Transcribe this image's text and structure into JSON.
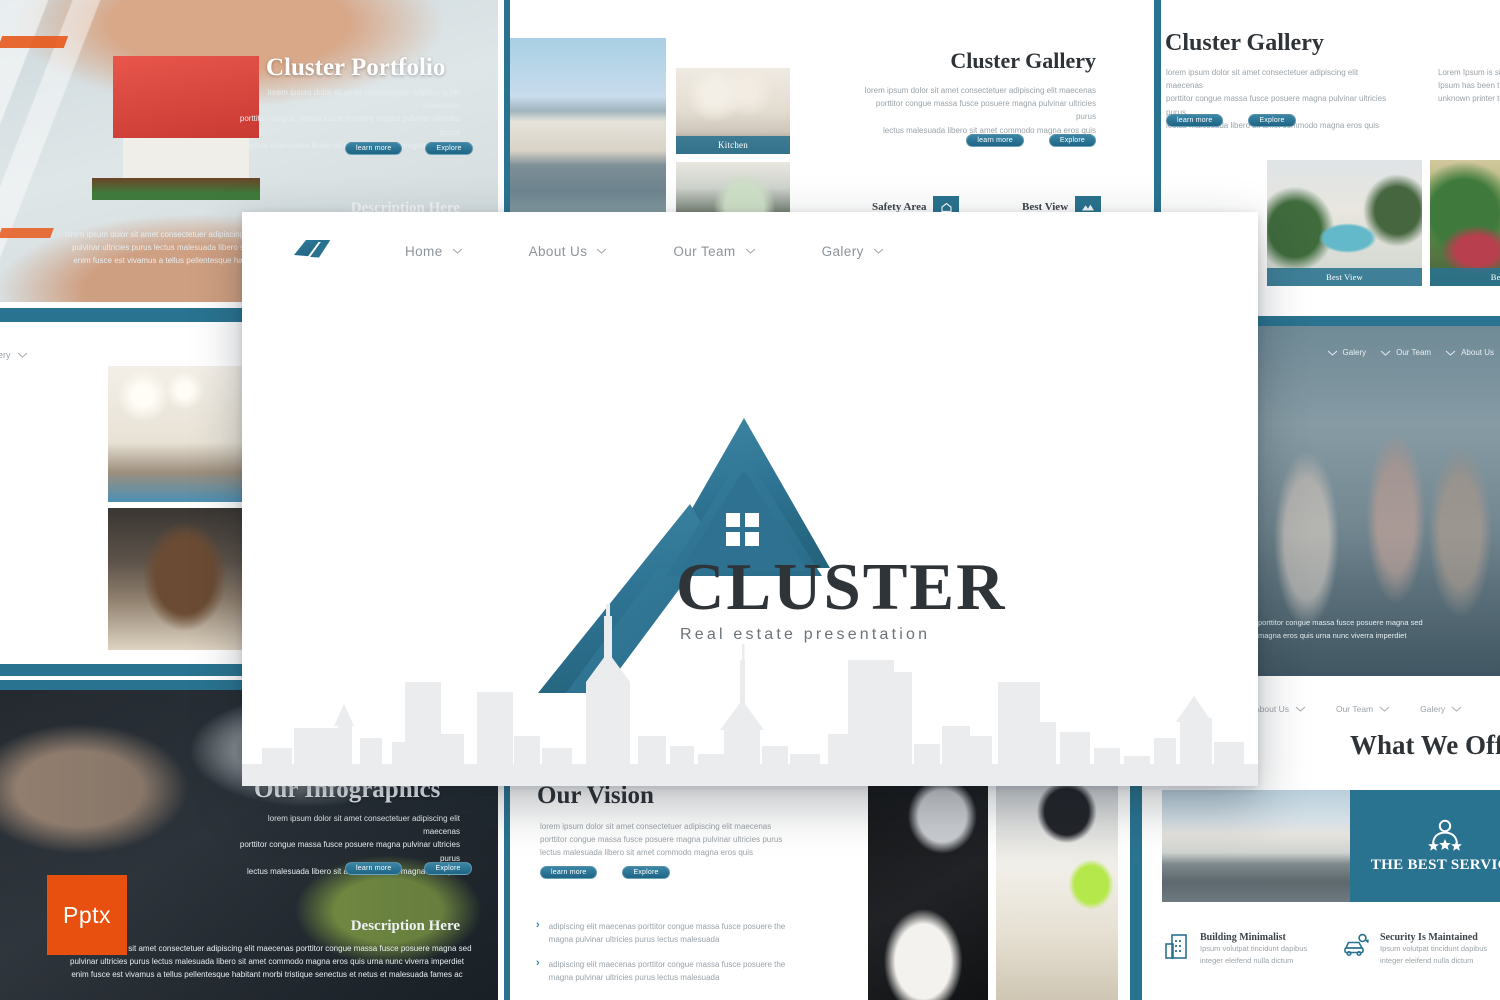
{
  "theme": {
    "accent": "#2a7390",
    "accent_light": "#3a86a6",
    "accent_dark": "#1f6484",
    "badge_orange": "#e8500f",
    "text_dark": "#2e3338",
    "text_muted": "#9aa3a9"
  },
  "card": {
    "navbar": {
      "logo_icon": "cluster-mark-icon",
      "items": [
        {
          "label": "Home",
          "icon": "chevron-down-icon"
        },
        {
          "label": "About Us",
          "icon": "chevron-down-icon"
        },
        {
          "label": "Our Team",
          "icon": "chevron-down-icon"
        },
        {
          "label": "Galery",
          "icon": "chevron-down-icon"
        }
      ]
    },
    "hero": {
      "logo_icon": "house-roof-a-icon",
      "window_icon": "four-pane-window-icon",
      "brand": "CLUSTER",
      "tagline": "Real estate presentation",
      "skyline_icon": "city-skyline-icon"
    }
  },
  "lorem": {
    "line1": "lorem ipsum dolor sit amet consectetuer adipiscing elit maecenas",
    "line2": "porttitor congue massa fusce posuere magna pulvinar ultricies purus",
    "line3": "lectus malesuada libero sit amet commodo magna eros quis",
    "desc_line1": "lorem ipsum dolor sit amet consectetuer adipiscing elit maecenas porttitor congue massa fusce posuere magna sed",
    "desc_line2": "pulvinar ultricies purus lectus malesuada libero sit amet commodo magna eros quis urna nunc viverra imperdiet",
    "desc_line3": "enim fusce est vivamus a tellus pellentesque habitant morbi tristique senectus et netus et malesuada fames ac",
    "bullet": "adipiscing elit maecenas porttitor congue massa fusce posuere the magna pulvinar ultricies purus lectus malesuada",
    "ipsum_col1": "Lorem Ipsum is simply",
    "ipsum_col2": "Ipsum has been the",
    "ipsum_col3": "unknown printer to",
    "team_line1": "porttitor congue massa fusce posuere magna sed",
    "team_line2": "magna eros quis urna nunc viverra imperdiet",
    "team_left": "rem",
    "team_left2": "purus"
  },
  "buttons": {
    "learn_more": "learn more",
    "explore": "Explore"
  },
  "slides": {
    "portfolio": {
      "title": "Cluster Portfolio",
      "description_heading": "Description Here"
    },
    "gallery_mid": {
      "title": "Cluster Gallery",
      "features": [
        {
          "label": "Safety Area",
          "icon": "shield-house-icon"
        },
        {
          "label": "Best View",
          "icon": "mountain-view-icon"
        }
      ],
      "photo_captions": [
        "Kitchen"
      ]
    },
    "gallery_right": {
      "title": "Cluster Gallery",
      "photo_captions": [
        "Best View",
        "Beautiful"
      ]
    },
    "team": {
      "nav_items": [
        {
          "label": "Galery",
          "icon": "chevron-down-icon"
        },
        {
          "label": "Our Team",
          "icon": "chevron-down-icon"
        },
        {
          "label": "About Us",
          "icon": "chevron-down-icon"
        }
      ]
    },
    "infographics": {
      "title": "Our Infographics",
      "description_heading": "Description Here",
      "badge": "Pptx"
    },
    "vision": {
      "title": "Our Vision",
      "bullet_icon": "chevron-right-icon"
    },
    "offer": {
      "title": "What We Offer",
      "nav_items": [
        {
          "label": "About Us",
          "icon": "chevron-down-icon"
        },
        {
          "label": "Our Team",
          "icon": "chevron-down-icon"
        },
        {
          "label": "Galery",
          "icon": "chevron-down-icon"
        }
      ],
      "banner": {
        "text": "THE BEST SERVICE",
        "icon": "person-three-stars-icon"
      },
      "features": [
        {
          "icon": "building-icon",
          "title": "Building Minimalist",
          "line1": "Ipsum volutpat tincidunt dapibus",
          "line2": "integer eleifend nulla dictum"
        },
        {
          "icon": "security-car-icon",
          "title": "Security Is Maintained",
          "line1": "Ipsum volutpat tincidunt dapibus",
          "line2": "integer eleifend nulla dictum"
        }
      ]
    },
    "left_mid": {
      "nav_items": [
        {
          "label": "Galery",
          "icon": "chevron-down-icon"
        }
      ]
    }
  }
}
